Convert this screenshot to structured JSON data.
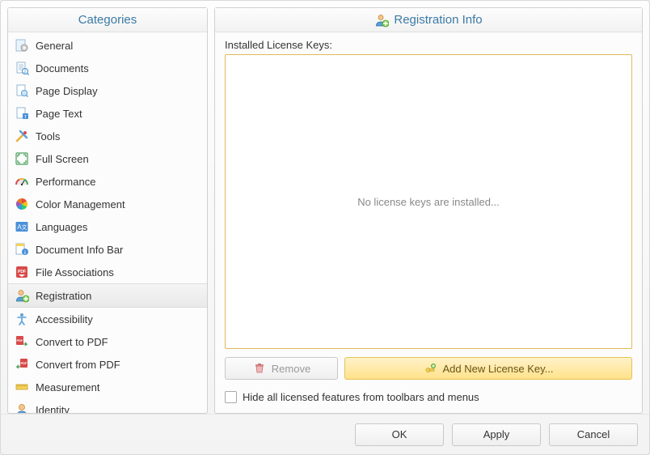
{
  "categories": {
    "header": "Categories",
    "items": [
      {
        "label": "General",
        "icon": "gear"
      },
      {
        "label": "Documents",
        "icon": "doc"
      },
      {
        "label": "Page Display",
        "icon": "page-magnify"
      },
      {
        "label": "Page Text",
        "icon": "page-text"
      },
      {
        "label": "Tools",
        "icon": "tools"
      },
      {
        "label": "Full Screen",
        "icon": "fullscreen"
      },
      {
        "label": "Performance",
        "icon": "gauge"
      },
      {
        "label": "Color Management",
        "icon": "color-wheel"
      },
      {
        "label": "Languages",
        "icon": "languages"
      },
      {
        "label": "Document Info Bar",
        "icon": "infobar"
      },
      {
        "label": "File Associations",
        "icon": "file-assoc"
      },
      {
        "label": "Registration",
        "icon": "person-plus",
        "selected": true
      },
      {
        "label": "Accessibility",
        "icon": "accessibility"
      },
      {
        "label": "Convert to PDF",
        "icon": "convert-to"
      },
      {
        "label": "Convert from PDF",
        "icon": "convert-from"
      },
      {
        "label": "Measurement",
        "icon": "ruler"
      },
      {
        "label": "Identity",
        "icon": "identity"
      }
    ]
  },
  "content": {
    "header": "Registration Info",
    "installed_label": "Installed License Keys:",
    "empty_text": "No license keys are installed...",
    "remove_label": "Remove",
    "add_label": "Add New License Key...",
    "hide_label": "Hide all licensed features from toolbars and menus",
    "hide_checked": false
  },
  "buttons": {
    "ok": "OK",
    "apply": "Apply",
    "cancel": "Cancel"
  }
}
